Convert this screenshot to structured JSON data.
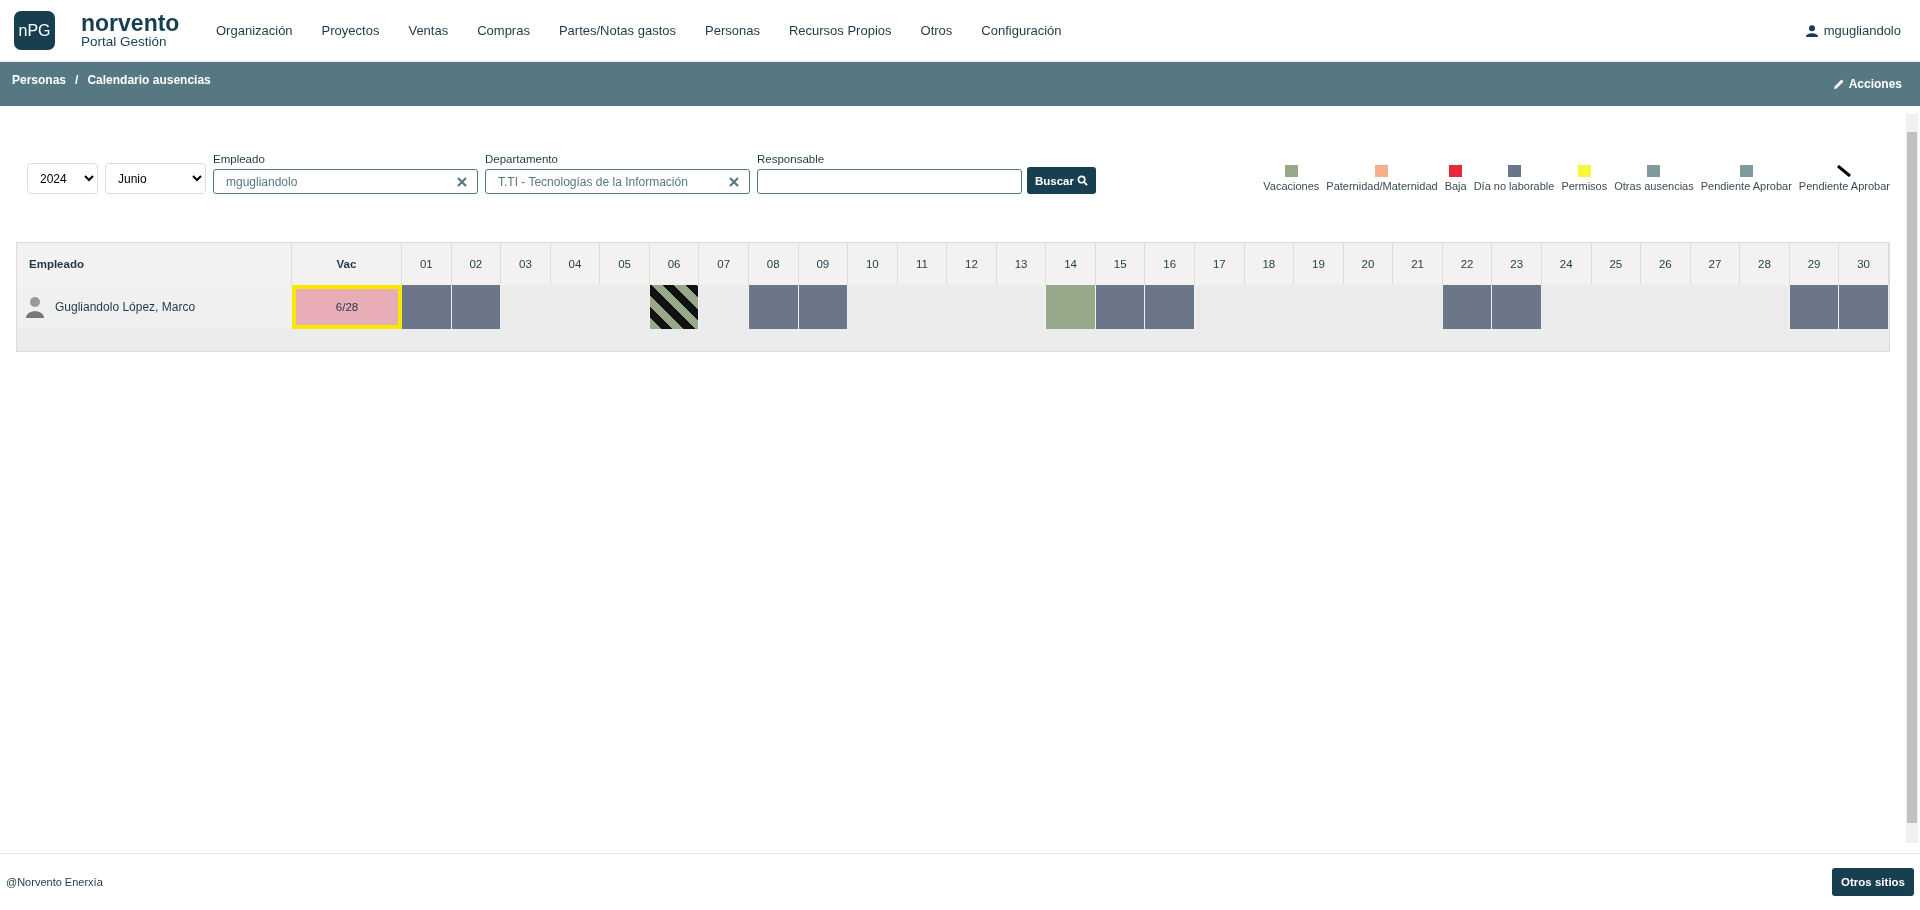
{
  "header": {
    "logo_badge": "nPG",
    "brand": "norvento",
    "subtitle": "Portal Gestión",
    "nav": [
      "Organización",
      "Proyectos",
      "Ventas",
      "Compras",
      "Partes/Notas gastos",
      "Personas",
      "Recursos Propios",
      "Otros",
      "Configuración"
    ],
    "user": "mgugliandolo"
  },
  "breadcrumb": {
    "items": [
      "Personas",
      "Calendario ausencias"
    ],
    "separator": "/",
    "action": "Acciones"
  },
  "filters": {
    "year": "2024",
    "month": "Junio",
    "employee": {
      "label": "Empleado",
      "value": "mgugliandolo"
    },
    "department": {
      "label": "Departamento",
      "value": "T.TI - Tecnologías de la Información"
    },
    "manager": {
      "label": "Responsable"
    },
    "search_button": "Buscar"
  },
  "legend": [
    {
      "label": "Vacaciones",
      "kind": "swatch",
      "color": "#97a98a"
    },
    {
      "label": "Paternidad/Maternidad",
      "kind": "swatch",
      "color": "#f4b08c"
    },
    {
      "label": "Baja",
      "kind": "swatch",
      "color": "#e8283e"
    },
    {
      "label": "Día no laborable",
      "kind": "swatch",
      "color": "#6b7789"
    },
    {
      "label": "Permisos",
      "kind": "swatch",
      "color": "#f7f73c"
    },
    {
      "label": "Otras ausencias",
      "kind": "swatch",
      "color": "#7f9a9a"
    },
    {
      "label": "Pendiente Aprobar",
      "kind": "swatch",
      "color": "#7f9a9a"
    },
    {
      "label": "Pendiente Aprobar",
      "kind": "stripe"
    }
  ],
  "table": {
    "columns": [
      "Empleado",
      "Vac"
    ],
    "days": [
      "01",
      "02",
      "03",
      "04",
      "05",
      "06",
      "07",
      "08",
      "09",
      "10",
      "11",
      "12",
      "13",
      "14",
      "15",
      "16",
      "17",
      "18",
      "19",
      "20",
      "21",
      "22",
      "23",
      "24",
      "25",
      "26",
      "27",
      "28",
      "29",
      "30"
    ],
    "rows": [
      {
        "name": "Gugliandolo López, Marco",
        "vac": "6/28",
        "days": [
          {
            "kind": "nolaboral"
          },
          {
            "kind": "nolaboral"
          },
          {
            "kind": "none"
          },
          {
            "kind": "none"
          },
          {
            "kind": "none"
          },
          {
            "kind": "pending"
          },
          {
            "kind": "none"
          },
          {
            "kind": "nolaboral"
          },
          {
            "kind": "nolaboral"
          },
          {
            "kind": "none"
          },
          {
            "kind": "none"
          },
          {
            "kind": "none"
          },
          {
            "kind": "none"
          },
          {
            "kind": "vacaciones"
          },
          {
            "kind": "nolaboral"
          },
          {
            "kind": "nolaboral"
          },
          {
            "kind": "none"
          },
          {
            "kind": "none"
          },
          {
            "kind": "none"
          },
          {
            "kind": "none"
          },
          {
            "kind": "none"
          },
          {
            "kind": "nolaboral"
          },
          {
            "kind": "nolaboral"
          },
          {
            "kind": "none"
          },
          {
            "kind": "none"
          },
          {
            "kind": "none"
          },
          {
            "kind": "none"
          },
          {
            "kind": "none"
          },
          {
            "kind": "nolaboral"
          },
          {
            "kind": "nolaboral"
          }
        ]
      }
    ]
  },
  "footer": {
    "copyright": "@Norvento Enerxía",
    "button": "Otros sitios"
  }
}
